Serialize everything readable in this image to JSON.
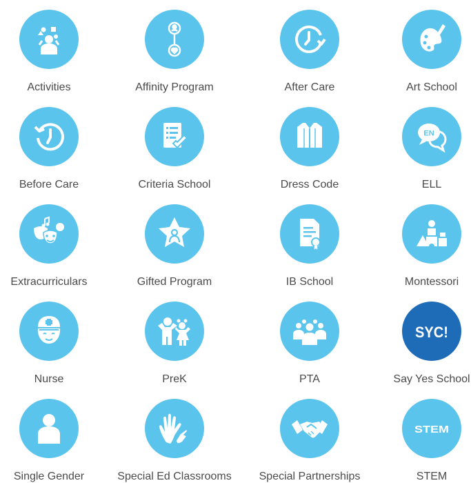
{
  "colors": {
    "icon_bg": "#5bc4ed",
    "icon_bg_dark": "#1e6cb8",
    "icon_fg": "#ffffff",
    "label": "#4a4a4a"
  },
  "tiles": [
    {
      "label": "Activities",
      "icon": "activities-icon"
    },
    {
      "label": "Affinity Program",
      "icon": "affinity-program-icon"
    },
    {
      "label": "After Care",
      "icon": "clock-forward-icon"
    },
    {
      "label": "Art School",
      "icon": "palette-brush-icon"
    },
    {
      "label": "Before Care",
      "icon": "clock-back-icon"
    },
    {
      "label": "Criteria School",
      "icon": "checklist-icon"
    },
    {
      "label": "Dress Code",
      "icon": "shirt-icon"
    },
    {
      "label": "ELL",
      "icon": "speech-bubbles-en-icon",
      "icon_text": "EN"
    },
    {
      "label": "Extracurriculars",
      "icon": "theater-masks-icon"
    },
    {
      "label": "Gifted Program",
      "icon": "star-person-icon"
    },
    {
      "label": "IB School",
      "icon": "certificate-icon"
    },
    {
      "label": "Montessori",
      "icon": "building-blocks-icon"
    },
    {
      "label": "Nurse",
      "icon": "nurse-icon"
    },
    {
      "label": "PreK",
      "icon": "children-icon"
    },
    {
      "label": "PTA",
      "icon": "group-icon"
    },
    {
      "label": "Say Yes School",
      "icon": "syc-logo-icon",
      "icon_text": "SYC!"
    },
    {
      "label": "Single Gender",
      "icon": "person-icon"
    },
    {
      "label": "Special Ed Classrooms",
      "icon": "helping-hands-icon"
    },
    {
      "label": "Special Partnerships",
      "icon": "handshake-icon"
    },
    {
      "label": "STEM",
      "icon": "stem-badge-icon",
      "icon_text": "STEM"
    }
  ]
}
